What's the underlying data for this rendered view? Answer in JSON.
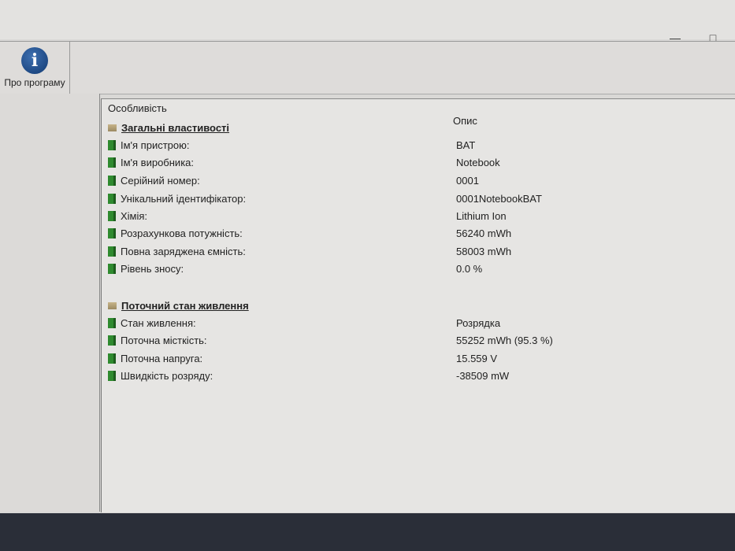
{
  "toolbar": {
    "about_label": "Про програму"
  },
  "columns": {
    "feature": "Особливість",
    "description": "Опис"
  },
  "groups": [
    {
      "title": "Загальні властивості",
      "rows": [
        {
          "label": "Ім'я пристрою:",
          "value": "BAT"
        },
        {
          "label": "Ім'я виробника:",
          "value": "Notebook"
        },
        {
          "label": "Серійний номер:",
          "value": "0001"
        },
        {
          "label": "Унікальний ідентифікатор:",
          "value": "0001NotebookBAT"
        },
        {
          "label": "Хімія:",
          "value": "Lithium Ion"
        },
        {
          "label": "Розрахункова потужність:",
          "value": "56240 mWh"
        },
        {
          "label": "Повна заряджена ємність:",
          "value": "58003 mWh"
        },
        {
          "label": "Рівень зносу:",
          "value": "0.0 %"
        }
      ]
    },
    {
      "title": "Поточний стан живлення",
      "rows": [
        {
          "label": "Стан живлення:",
          "value": "Розрядка"
        },
        {
          "label": "Поточна місткість:",
          "value": "55252 mWh (95.3 %)"
        },
        {
          "label": "Поточна напруга:",
          "value": "15.559 V"
        },
        {
          "label": "Швидкість розряду:",
          "value": "-38509 mW"
        }
      ]
    }
  ]
}
